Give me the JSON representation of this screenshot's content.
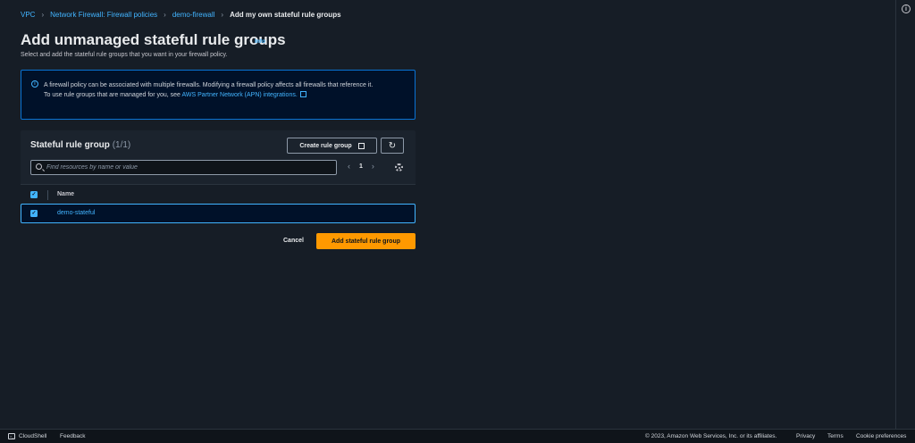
{
  "breadcrumb": {
    "items": [
      "VPC",
      "Network Firewall: Firewall policies",
      "demo-firewall"
    ],
    "current": "Add my own stateful rule groups"
  },
  "page": {
    "title": "Add unmanaged stateful rule groups",
    "info_label": "Info",
    "description": "Select and add the stateful rule groups that you want in your firewall policy."
  },
  "alert": {
    "line1": "A firewall policy can be associated with multiple firewalls. Modifying a firewall policy affects all firewalls that reference it.",
    "line2_prefix": "To use rule groups that are managed for you, see ",
    "link": "AWS Partner Network (APN) integrations."
  },
  "table": {
    "title": "Stateful rule group",
    "count": "(1/1)",
    "create_button": "Create rule group",
    "search_placeholder": "Find resources by name or value",
    "page_number": "1",
    "column_name": "Name",
    "rows": [
      {
        "name": "demo-stateful",
        "selected": true
      }
    ]
  },
  "actions": {
    "cancel": "Cancel",
    "primary": "Add stateful rule group"
  },
  "footer": {
    "cloudshell": "CloudShell",
    "feedback": "Feedback",
    "copyright": "© 2023, Amazon Web Services, Inc. or its affiliates.",
    "privacy": "Privacy",
    "terms": "Terms",
    "cookies": "Cookie preferences"
  },
  "colors": {
    "background": "#161d26",
    "link": "#42b4ff",
    "primary_button": "#ff9900",
    "info_border": "#0972d3"
  },
  "icons": [
    "chevron-right-icon",
    "info-icon",
    "external-link-icon",
    "refresh-icon",
    "search-icon",
    "chevron-left-icon",
    "settings-icon",
    "checkbox-icon",
    "cloudshell-icon"
  ]
}
